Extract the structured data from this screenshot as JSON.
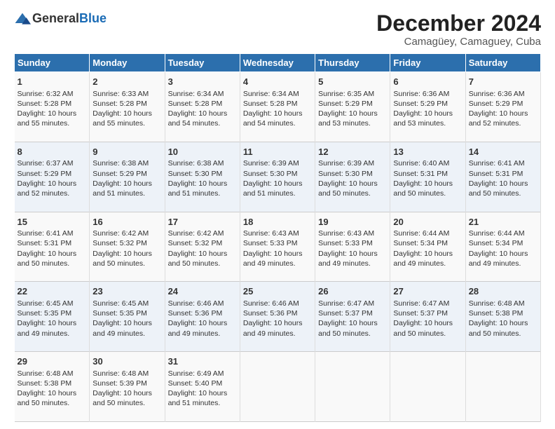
{
  "header": {
    "logo_general": "General",
    "logo_blue": "Blue",
    "month": "December 2024",
    "location": "Camagüey, Camaguey, Cuba"
  },
  "days_of_week": [
    "Sunday",
    "Monday",
    "Tuesday",
    "Wednesday",
    "Thursday",
    "Friday",
    "Saturday"
  ],
  "weeks": [
    [
      {
        "day": 1,
        "sunrise": "6:32 AM",
        "sunset": "5:28 PM",
        "daylight": "10 hours and 55 minutes."
      },
      {
        "day": 2,
        "sunrise": "6:33 AM",
        "sunset": "5:28 PM",
        "daylight": "10 hours and 55 minutes."
      },
      {
        "day": 3,
        "sunrise": "6:34 AM",
        "sunset": "5:28 PM",
        "daylight": "10 hours and 54 minutes."
      },
      {
        "day": 4,
        "sunrise": "6:34 AM",
        "sunset": "5:28 PM",
        "daylight": "10 hours and 54 minutes."
      },
      {
        "day": 5,
        "sunrise": "6:35 AM",
        "sunset": "5:29 PM",
        "daylight": "10 hours and 53 minutes."
      },
      {
        "day": 6,
        "sunrise": "6:36 AM",
        "sunset": "5:29 PM",
        "daylight": "10 hours and 53 minutes."
      },
      {
        "day": 7,
        "sunrise": "6:36 AM",
        "sunset": "5:29 PM",
        "daylight": "10 hours and 52 minutes."
      }
    ],
    [
      {
        "day": 8,
        "sunrise": "6:37 AM",
        "sunset": "5:29 PM",
        "daylight": "10 hours and 52 minutes."
      },
      {
        "day": 9,
        "sunrise": "6:38 AM",
        "sunset": "5:29 PM",
        "daylight": "10 hours and 51 minutes."
      },
      {
        "day": 10,
        "sunrise": "6:38 AM",
        "sunset": "5:30 PM",
        "daylight": "10 hours and 51 minutes."
      },
      {
        "day": 11,
        "sunrise": "6:39 AM",
        "sunset": "5:30 PM",
        "daylight": "10 hours and 51 minutes."
      },
      {
        "day": 12,
        "sunrise": "6:39 AM",
        "sunset": "5:30 PM",
        "daylight": "10 hours and 50 minutes."
      },
      {
        "day": 13,
        "sunrise": "6:40 AM",
        "sunset": "5:31 PM",
        "daylight": "10 hours and 50 minutes."
      },
      {
        "day": 14,
        "sunrise": "6:41 AM",
        "sunset": "5:31 PM",
        "daylight": "10 hours and 50 minutes."
      }
    ],
    [
      {
        "day": 15,
        "sunrise": "6:41 AM",
        "sunset": "5:31 PM",
        "daylight": "10 hours and 50 minutes."
      },
      {
        "day": 16,
        "sunrise": "6:42 AM",
        "sunset": "5:32 PM",
        "daylight": "10 hours and 50 minutes."
      },
      {
        "day": 17,
        "sunrise": "6:42 AM",
        "sunset": "5:32 PM",
        "daylight": "10 hours and 50 minutes."
      },
      {
        "day": 18,
        "sunrise": "6:43 AM",
        "sunset": "5:33 PM",
        "daylight": "10 hours and 49 minutes."
      },
      {
        "day": 19,
        "sunrise": "6:43 AM",
        "sunset": "5:33 PM",
        "daylight": "10 hours and 49 minutes."
      },
      {
        "day": 20,
        "sunrise": "6:44 AM",
        "sunset": "5:34 PM",
        "daylight": "10 hours and 49 minutes."
      },
      {
        "day": 21,
        "sunrise": "6:44 AM",
        "sunset": "5:34 PM",
        "daylight": "10 hours and 49 minutes."
      }
    ],
    [
      {
        "day": 22,
        "sunrise": "6:45 AM",
        "sunset": "5:35 PM",
        "daylight": "10 hours and 49 minutes."
      },
      {
        "day": 23,
        "sunrise": "6:45 AM",
        "sunset": "5:35 PM",
        "daylight": "10 hours and 49 minutes."
      },
      {
        "day": 24,
        "sunrise": "6:46 AM",
        "sunset": "5:36 PM",
        "daylight": "10 hours and 49 minutes."
      },
      {
        "day": 25,
        "sunrise": "6:46 AM",
        "sunset": "5:36 PM",
        "daylight": "10 hours and 49 minutes."
      },
      {
        "day": 26,
        "sunrise": "6:47 AM",
        "sunset": "5:37 PM",
        "daylight": "10 hours and 50 minutes."
      },
      {
        "day": 27,
        "sunrise": "6:47 AM",
        "sunset": "5:37 PM",
        "daylight": "10 hours and 50 minutes."
      },
      {
        "day": 28,
        "sunrise": "6:48 AM",
        "sunset": "5:38 PM",
        "daylight": "10 hours and 50 minutes."
      }
    ],
    [
      {
        "day": 29,
        "sunrise": "6:48 AM",
        "sunset": "5:38 PM",
        "daylight": "10 hours and 50 minutes."
      },
      {
        "day": 30,
        "sunrise": "6:48 AM",
        "sunset": "5:39 PM",
        "daylight": "10 hours and 50 minutes."
      },
      {
        "day": 31,
        "sunrise": "6:49 AM",
        "sunset": "5:40 PM",
        "daylight": "10 hours and 51 minutes."
      },
      null,
      null,
      null,
      null
    ]
  ]
}
